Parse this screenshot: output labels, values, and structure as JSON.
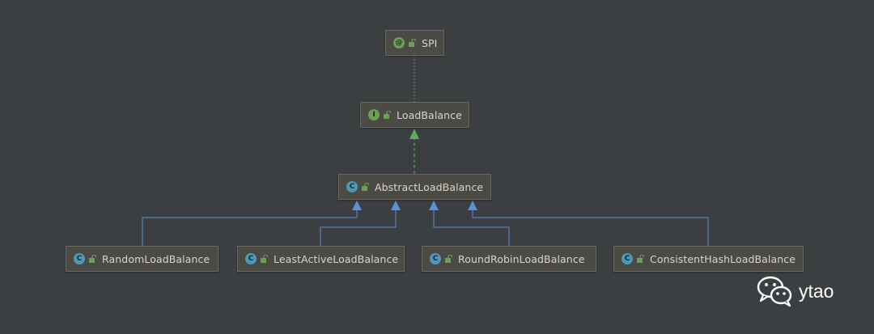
{
  "nodes": {
    "spi": {
      "label": "SPI",
      "badge": "@",
      "badge_kind": "annotation",
      "icon": "annotation-icon"
    },
    "load_balance": {
      "label": "LoadBalance",
      "badge": "I",
      "badge_kind": "interface",
      "icon": "interface-icon"
    },
    "abstract_load_balance": {
      "label": "AbstractLoadBalance",
      "badge": "C",
      "badge_kind": "class",
      "icon": "class-icon"
    },
    "random_load_balance": {
      "label": "RandomLoadBalance",
      "badge": "C",
      "badge_kind": "class",
      "icon": "class-icon"
    },
    "least_active_load_balance": {
      "label": "LeastActiveLoadBalance",
      "badge": "C",
      "badge_kind": "class",
      "icon": "class-icon"
    },
    "round_robin_load_balance": {
      "label": "RoundRobinLoadBalance",
      "badge": "C",
      "badge_kind": "class",
      "icon": "class-icon"
    },
    "consistent_hash_load_balance": {
      "label": "ConsistentHashLoadBalance",
      "badge": "C",
      "badge_kind": "class",
      "icon": "class-icon"
    }
  },
  "edges": [
    {
      "from": "spi",
      "to": "load_balance",
      "kind": "annotated-by"
    },
    {
      "from": "abstract_load_balance",
      "to": "load_balance",
      "kind": "implements"
    },
    {
      "from": "random_load_balance",
      "to": "abstract_load_balance",
      "kind": "extends"
    },
    {
      "from": "least_active_load_balance",
      "to": "abstract_load_balance",
      "kind": "extends"
    },
    {
      "from": "round_robin_load_balance",
      "to": "abstract_load_balance",
      "kind": "extends"
    },
    {
      "from": "consistent_hash_load_balance",
      "to": "abstract_load_balance",
      "kind": "extends"
    }
  ],
  "colors": {
    "background": "#3c3f41",
    "extends_line": "#5d8fd8",
    "implements_line": "#5fa85f",
    "annotation_line": "#8a8a7a"
  },
  "watermark": {
    "text": "ytao",
    "icon": "wechat-icon"
  }
}
